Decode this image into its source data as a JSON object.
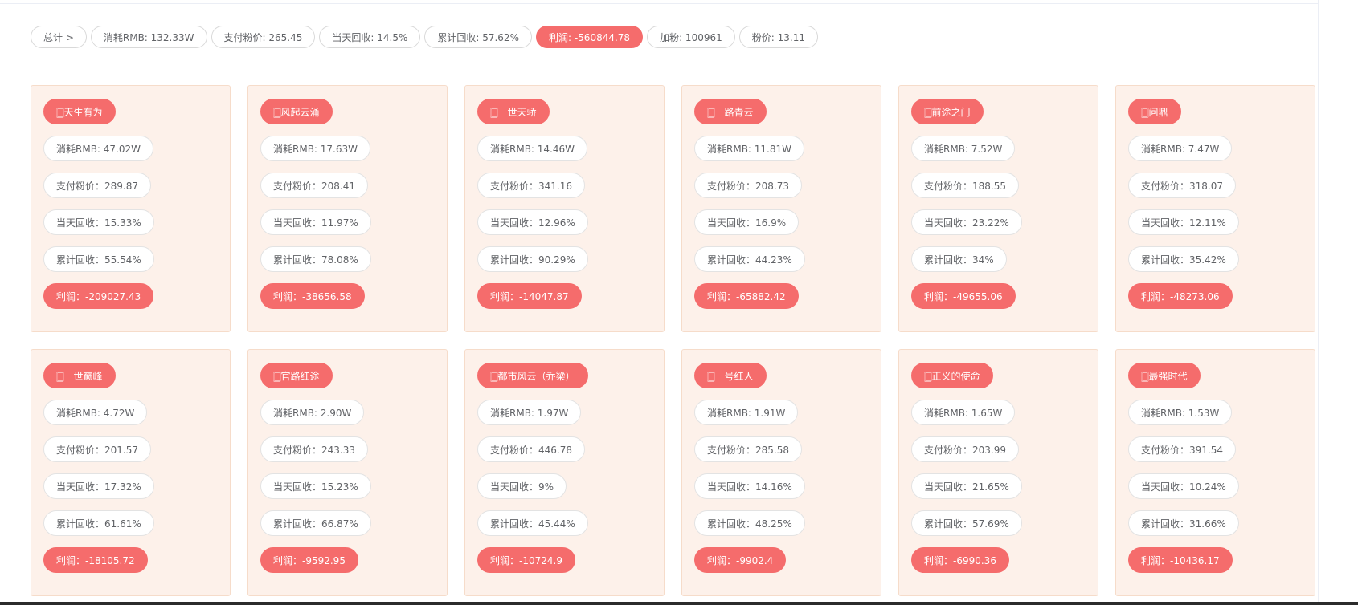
{
  "summary": {
    "total_label": "总计 >",
    "items": [
      "消耗RMB: 132.33W",
      "支付粉价: 265.45",
      "当天回收: 14.5%",
      "累计回收: 57.62%",
      "利润: -560844.78",
      "加粉: 100961",
      "粉价: 13.11"
    ]
  },
  "cards": [
    {
      "title": "🀆天生有为",
      "consume": "消耗RMB: 47.02W",
      "pay_price": "支付粉价：289.87",
      "day_recovery": "当天回收：15.33%",
      "cum_recovery": "累计回收：55.54%",
      "profit": "利润：-209027.43"
    },
    {
      "title": "🀆风起云涌",
      "consume": "消耗RMB: 17.63W",
      "pay_price": "支付粉价：208.41",
      "day_recovery": "当天回收：11.97%",
      "cum_recovery": "累计回收：78.08%",
      "profit": "利润：-38656.58"
    },
    {
      "title": "🀆一世天骄",
      "consume": "消耗RMB: 14.46W",
      "pay_price": "支付粉价：341.16",
      "day_recovery": "当天回收：12.96%",
      "cum_recovery": "累计回收：90.29%",
      "profit": "利润：-14047.87"
    },
    {
      "title": "🀆一路青云",
      "consume": "消耗RMB: 11.81W",
      "pay_price": "支付粉价：208.73",
      "day_recovery": "当天回收：16.9%",
      "cum_recovery": "累计回收：44.23%",
      "profit": "利润：-65882.42"
    },
    {
      "title": "🀆前途之门",
      "consume": "消耗RMB: 7.52W",
      "pay_price": "支付粉价：188.55",
      "day_recovery": "当天回收：23.22%",
      "cum_recovery": "累计回收：34%",
      "profit": "利润：-49655.06"
    },
    {
      "title": "🀆问鼎",
      "consume": "消耗RMB: 7.47W",
      "pay_price": "支付粉价：318.07",
      "day_recovery": "当天回收：12.11%",
      "cum_recovery": "累计回收：35.42%",
      "profit": "利润：-48273.06"
    },
    {
      "title": "🀆一世巅峰",
      "consume": "消耗RMB: 4.72W",
      "pay_price": "支付粉价：201.57",
      "day_recovery": "当天回收：17.32%",
      "cum_recovery": "累计回收：61.61%",
      "profit": "利润：-18105.72"
    },
    {
      "title": "🀆官路红途",
      "consume": "消耗RMB: 2.90W",
      "pay_price": "支付粉价：243.33",
      "day_recovery": "当天回收：15.23%",
      "cum_recovery": "累计回收：66.87%",
      "profit": "利润：-9592.95"
    },
    {
      "title": "🀆都市风云（乔梁）",
      "consume": "消耗RMB: 1.97W",
      "pay_price": "支付粉价：446.78",
      "day_recovery": "当天回收：9%",
      "cum_recovery": "累计回收：45.44%",
      "profit": "利润：-10724.9"
    },
    {
      "title": "🀆一号红人",
      "consume": "消耗RMB: 1.91W",
      "pay_price": "支付粉价：285.58",
      "day_recovery": "当天回收：14.16%",
      "cum_recovery": "累计回收：48.25%",
      "profit": "利润：-9902.4"
    },
    {
      "title": "🀆正义的使命",
      "consume": "消耗RMB: 1.65W",
      "pay_price": "支付粉价：203.99",
      "day_recovery": "当天回收：21.65%",
      "cum_recovery": "累计回收：57.69%",
      "profit": "利润：-6990.36"
    },
    {
      "title": "🀆最强时代",
      "consume": "消耗RMB: 1.53W",
      "pay_price": "支付粉价：391.54",
      "day_recovery": "当天回收：10.24%",
      "cum_recovery": "累计回收：31.66%",
      "profit": "利润：-10436.17"
    }
  ],
  "colors": {
    "accent_red": "#f56c6c",
    "card_bg": "#fdf1ea",
    "card_border": "#f6dcca"
  }
}
